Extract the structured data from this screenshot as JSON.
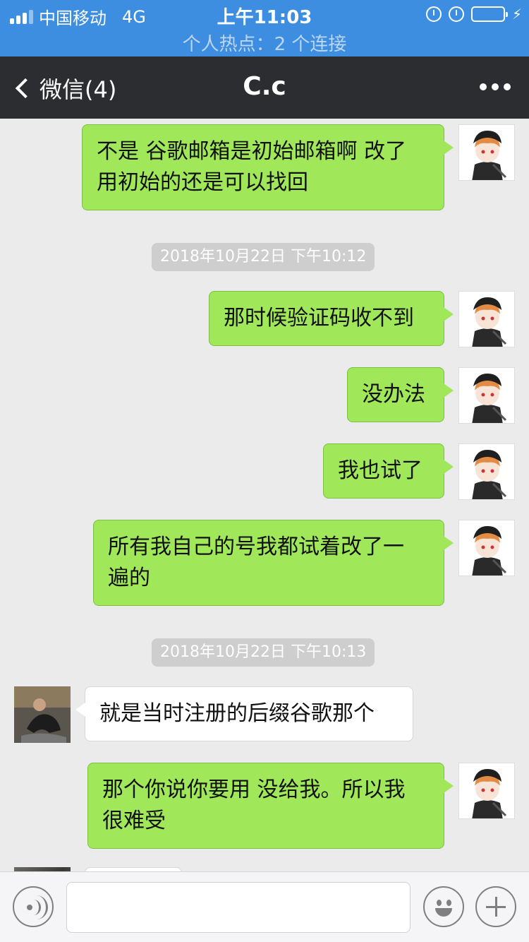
{
  "status_bar": {
    "carrier": "中国移动",
    "network": "4G",
    "time": "上午11:03",
    "hotspot": "个人热点：2 个连接",
    "icons": [
      "signal-icon",
      "rotation-lock-icon",
      "alarm-icon",
      "battery-icon",
      "charging-icon"
    ]
  },
  "nav": {
    "back_label": "微信(4)",
    "title": "C.c",
    "more_icon": "more-dots-icon"
  },
  "messages": [
    {
      "sender": "me",
      "lines": [
        "不是 谷歌邮箱是初始邮箱啊 改了",
        "用初始的还是可以找回"
      ]
    },
    {
      "type": "timestamp",
      "text": "2018年10月22日 下午10:12"
    },
    {
      "sender": "me",
      "lines": [
        "那时候验证码收不到"
      ]
    },
    {
      "sender": "me",
      "lines": [
        "没办法"
      ]
    },
    {
      "sender": "me",
      "lines": [
        "我也试了"
      ]
    },
    {
      "sender": "me",
      "lines": [
        "所有我自己的号我都试着改了一",
        "遍的"
      ]
    },
    {
      "type": "timestamp",
      "text": "2018年10月22日 下午10:13"
    },
    {
      "sender": "other",
      "lines": [
        "就是当时注册的后缀谷歌那个"
      ]
    },
    {
      "sender": "me",
      "lines": [
        "那个你说你要用 没给我。所以我",
        "很难受"
      ]
    }
  ],
  "input_bar": {
    "text_value": "",
    "icons": [
      "voice-icon",
      "emoji-icon",
      "plus-icon"
    ]
  },
  "colors": {
    "status_bar": "#3d8de0",
    "nav_bar": "#2c2d31",
    "background": "#ebebeb",
    "my_bubble": "#a0e75a",
    "other_bubble": "#ffffff",
    "timestamp_bg": "#cecece"
  }
}
